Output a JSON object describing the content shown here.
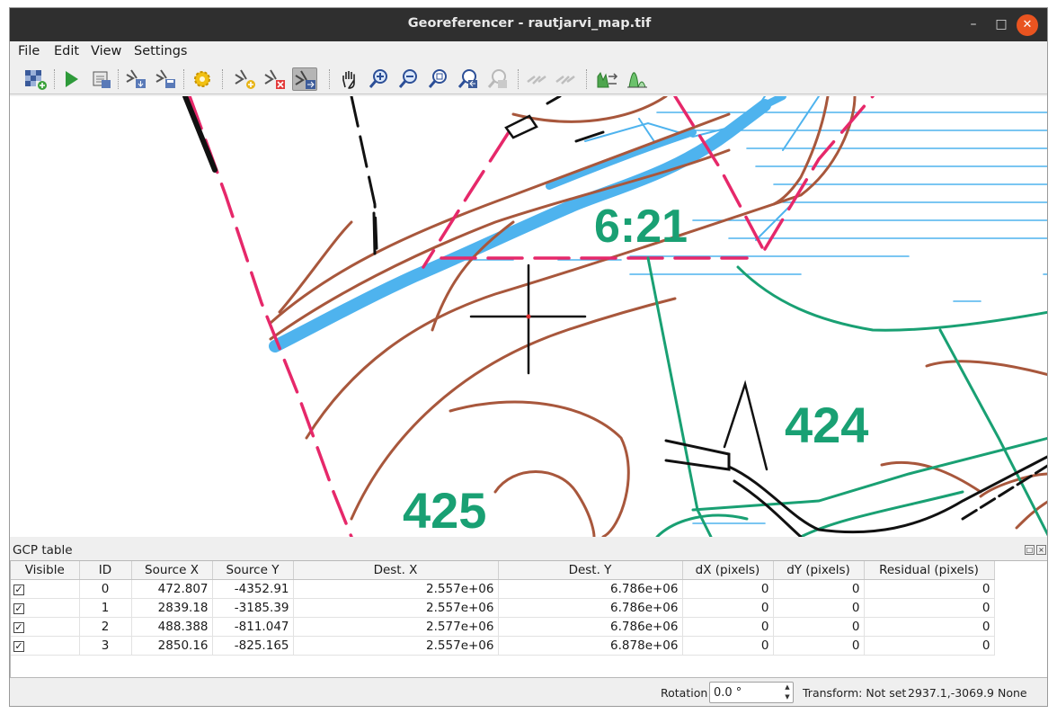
{
  "window": {
    "title": "Georeferencer - rautjarvi_map.tif"
  },
  "menu": [
    "File",
    "Edit",
    "View",
    "Settings"
  ],
  "toolbar": {
    "buttons": [
      "open-raster-icon",
      "start-georeferencing-icon",
      "generate-gdal-script-icon",
      "load-gcp-points-icon",
      "save-gcp-points-icon",
      "transformation-settings-icon",
      "add-point-icon",
      "delete-point-icon",
      "move-gcp-point-icon",
      "pan-icon",
      "zoom-in-icon",
      "zoom-out-icon",
      "zoom-to-layer-icon",
      "zoom-last-icon",
      "zoom-next-icon",
      "link-georeferencer-to-qgis-icon",
      "link-qgis-to-georeferencer-icon",
      "full-histogram-stretch-icon",
      "local-histogram-stretch-icon"
    ],
    "active": "move-gcp-point-icon"
  },
  "map": {
    "labels": [
      "6:21",
      "424",
      "425"
    ],
    "colors": {
      "water": "#4eb3ee",
      "contour": "#a8573c",
      "boundary": "#e6286a",
      "green": "#19a073",
      "road": "#111111"
    }
  },
  "gcp": {
    "title": "GCP table",
    "columns": [
      "Visible",
      "ID",
      "Source X",
      "Source Y",
      "Dest. X",
      "Dest. Y",
      "dX (pixels)",
      "dY (pixels)",
      "Residual (pixels)"
    ],
    "rows": [
      [
        "✓",
        "0",
        "472.807",
        "-4352.91",
        "2.557e+06",
        "6.786e+06",
        "0",
        "0",
        "0"
      ],
      [
        "✓",
        "1",
        "2839.18",
        "-3185.39",
        "2.557e+06",
        "6.786e+06",
        "0",
        "0",
        "0"
      ],
      [
        "✓",
        "2",
        "488.388",
        "-811.047",
        "2.577e+06",
        "6.786e+06",
        "0",
        "0",
        "0"
      ],
      [
        "✓",
        "3",
        "2850.16",
        "-825.165",
        "2.557e+06",
        "6.878e+06",
        "0",
        "0",
        "0"
      ]
    ]
  },
  "status": {
    "rotation_label": "Rotation",
    "rotation_value": "0.0 °",
    "transform": "Transform: Not set",
    "coordinates": "2937.1,-3069.9",
    "crs": "None"
  }
}
